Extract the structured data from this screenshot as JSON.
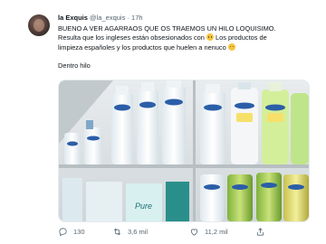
{
  "tweet": {
    "author_name": "la Exquis",
    "handle": "@la_exquis",
    "separator": "·",
    "time": "17h",
    "text_line1": "BUENO A VER AGARRAOS QUE OS TRAEMOS UN HILO LOQUISIMO.",
    "text_line2": "Resulta que los ingleses están obsesionados con",
    "text_line2_tail": "Los productos de",
    "text_line3": "limpieza españoles y los productos que huelen a nenuco",
    "text_line4": "Dentro hilo",
    "emojis": [
      "face-with-open-mouth",
      "face-with-open-mouth"
    ]
  },
  "photo": {
    "alt": "Shelves with Nenuco and Don Algodón cleaning products",
    "brand_labels": [
      "Nenuco",
      "Nenuco",
      "Nenuco",
      "Nenuco",
      "Nenuco",
      "Nenuco",
      "Nenuco",
      "Nenuco",
      "Nenuco",
      "Nenuco",
      "Nenuco"
    ],
    "product_text": [
      "Agua de Colonia",
      "Agua de Colonia",
      "Agua de Colonia",
      "Agua de Colonia"
    ],
    "pure_label": "Pure"
  },
  "actions": {
    "reply_count": "130",
    "retweet_count": "3,6 mil",
    "like_count": "11,2 mil"
  },
  "icons": {
    "reply": "reply-icon",
    "retweet": "retweet-icon",
    "like": "heart-icon",
    "share": "share-icon"
  }
}
